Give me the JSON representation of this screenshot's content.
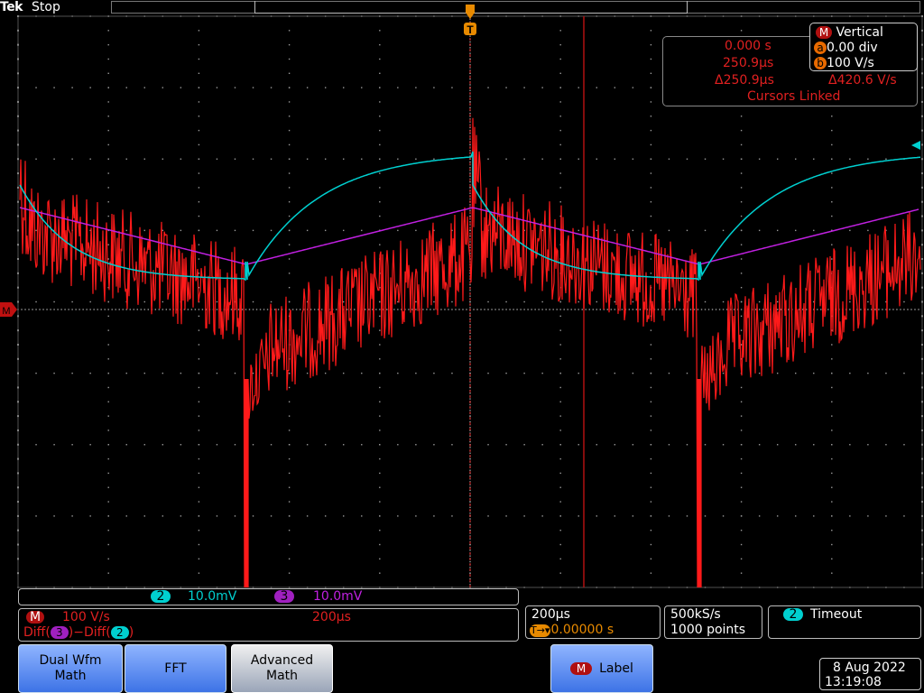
{
  "status": {
    "brand": "Tek",
    "run_state": "Stop"
  },
  "cursor_readout": {
    "cursor_a_time": "0.000 s",
    "cursor_b_time": "250.9µs",
    "delta_time": "Δ250.9µs",
    "delta_value": "Δ420.6 V/s",
    "link_state": "Cursors Linked"
  },
  "vertical_readout": {
    "title": "Vertical",
    "math_badge": "M",
    "a_badge": "a",
    "b_badge": "b",
    "cursor_a_value": "0.00 div",
    "cursor_b_value": "100 V/s"
  },
  "markers": {
    "trigger_position": "T",
    "math_ground": "M"
  },
  "channel_strip": {
    "ch2_badge": "2",
    "ch2_scale": "10.0mV",
    "ch3_badge": "3",
    "ch3_scale": "10.0mV"
  },
  "math_info": {
    "badge": "M",
    "scale": "100 V/s",
    "timebase": "200µs",
    "expr_prefix": "Diff(",
    "expr_ch3": "3",
    "expr_mid": ")−Diff(",
    "expr_ch2": "2",
    "expr_suffix": ")"
  },
  "timebase": {
    "scale": "200µs",
    "trigger_delay_icon": "T→▾",
    "position": "0.00000 s"
  },
  "acquisition": {
    "sample_rate": "500kS/s",
    "record_length": "1000 points"
  },
  "trigger_status": {
    "channel_badge": "2",
    "mode": "Timeout"
  },
  "menu": {
    "dual_wfm_math_line1": "Dual Wfm",
    "dual_wfm_math_line2": "Math",
    "fft": "FFT",
    "advanced_math_line1": "Advanced",
    "advanced_math_line2": "Math",
    "label_badge": "M",
    "label": "Label"
  },
  "datetime": {
    "date": "8 Aug 2022",
    "time": "13:19:08"
  },
  "colors": {
    "ch2": "#00d0d0",
    "ch3": "#c020e0",
    "math": "#ff1a1a",
    "cursor": "#c01010",
    "grid": "#9a9a9a",
    "button": "#3d73e6"
  }
}
